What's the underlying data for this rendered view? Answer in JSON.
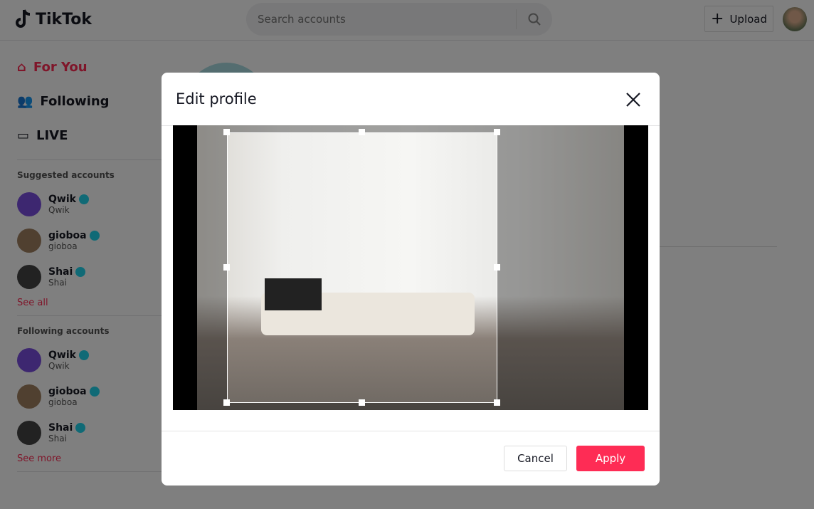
{
  "header": {
    "logo": "TikTok",
    "search_placeholder": "Search accounts",
    "upload_label": "Upload"
  },
  "sidebar": {
    "nav": [
      {
        "label": "For You",
        "icon": "home-icon"
      },
      {
        "label": "Following",
        "icon": "users-icon"
      },
      {
        "label": "LIVE",
        "icon": "video-icon"
      }
    ],
    "suggested_title": "Suggested accounts",
    "suggested": [
      {
        "name": "Qwik",
        "handle": "Qwik"
      },
      {
        "name": "gioboa",
        "handle": "gioboa"
      },
      {
        "name": "Shai",
        "handle": "Shai"
      }
    ],
    "see_all": "See all",
    "following_title": "Following accounts",
    "following": [
      {
        "name": "Qwik",
        "handle": "Qwik"
      },
      {
        "name": "gioboa",
        "handle": "gioboa"
      },
      {
        "name": "Shai",
        "handle": "Shai"
      }
    ],
    "see_more": "See more"
  },
  "modal": {
    "title": "Edit profile",
    "cancel_label": "Cancel",
    "apply_label": "Apply"
  },
  "colors": {
    "accent": "#fe2c55",
    "verified": "#20d5ec"
  }
}
